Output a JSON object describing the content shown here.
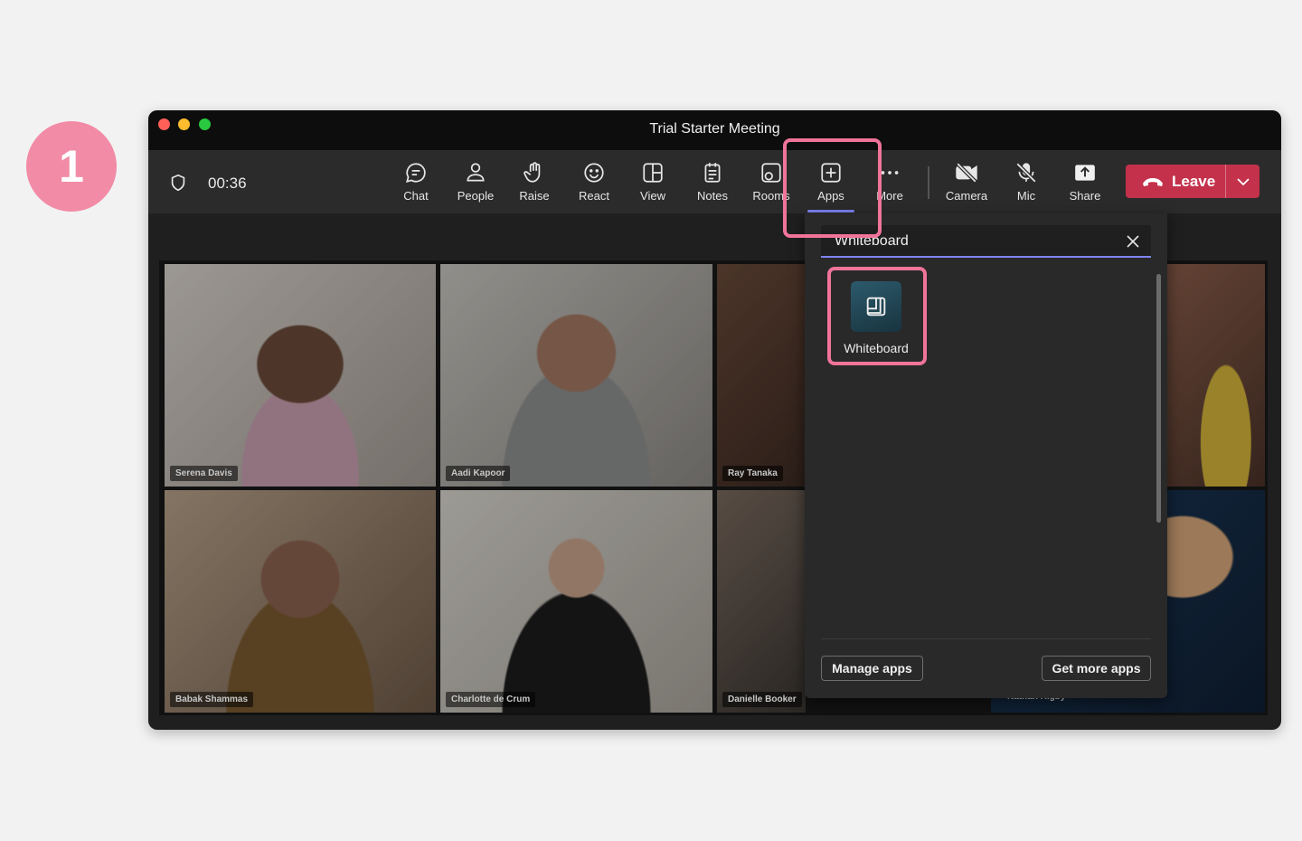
{
  "step_number": "1",
  "window": {
    "title": "Trial Starter Meeting"
  },
  "toolbar": {
    "timer": "00:36",
    "buttons": [
      {
        "label": "Chat",
        "icon": "chat-icon"
      },
      {
        "label": "People",
        "icon": "people-icon"
      },
      {
        "label": "Raise",
        "icon": "hand-icon"
      },
      {
        "label": "React",
        "icon": "smiley-icon"
      },
      {
        "label": "View",
        "icon": "view-grid-icon"
      },
      {
        "label": "Notes",
        "icon": "notes-icon"
      },
      {
        "label": "Rooms",
        "icon": "rooms-icon"
      },
      {
        "label": "Apps",
        "icon": "apps-plus-icon"
      },
      {
        "label": "More",
        "icon": "more-icon"
      },
      {
        "label": "Camera",
        "icon": "camera-off-icon"
      },
      {
        "label": "Mic",
        "icon": "mic-off-icon"
      },
      {
        "label": "Share",
        "icon": "share-icon"
      }
    ],
    "leave_label": "Leave"
  },
  "participants": [
    {
      "name": "Serena Davis"
    },
    {
      "name": "Aadi Kapoor"
    },
    {
      "name": "Ray Tanaka"
    },
    {
      "name": "Babak Shammas"
    },
    {
      "name": "Charlotte de Crum"
    },
    {
      "name": "Danielle Booker"
    },
    {
      "name": "Nathan Rigby"
    }
  ],
  "apps_panel": {
    "search_value": "Whiteboard",
    "results": [
      {
        "label": "Whiteboard",
        "icon": "whiteboard-icon"
      }
    ],
    "manage_label": "Manage apps",
    "get_more_label": "Get more apps"
  },
  "colors": {
    "accent": "#7f85f5",
    "leave": "#c4314b",
    "highlight": "#f0749a",
    "badge": "#f28ba6"
  }
}
